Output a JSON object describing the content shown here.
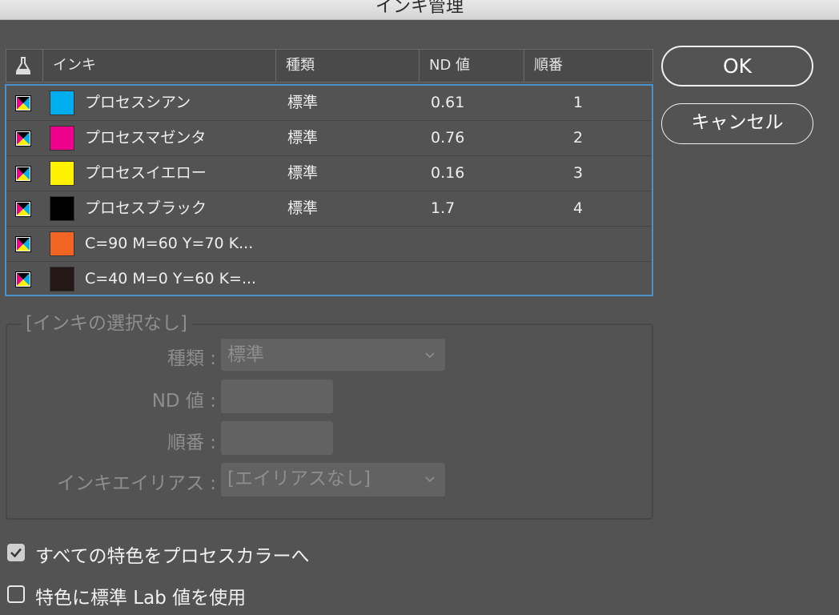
{
  "dialog": {
    "title": "インキ管理"
  },
  "table": {
    "columns": [
      "インキ",
      "種類",
      "ND 値",
      "順番"
    ],
    "rows": [
      {
        "name": "プロセスシアン",
        "type": "標準",
        "nd": "0.61",
        "order": "1",
        "color": "#00adef"
      },
      {
        "name": "プロセスマゼンタ",
        "type": "標準",
        "nd": "0.76",
        "order": "2",
        "color": "#ec008c"
      },
      {
        "name": "プロセスイエロー",
        "type": "標準",
        "nd": "0.16",
        "order": "3",
        "color": "#fff200"
      },
      {
        "name": "プロセスブラック",
        "type": "標準",
        "nd": "1.7",
        "order": "4",
        "color": "#000000"
      },
      {
        "name": "C=90 M=60 Y=70 K...",
        "type": "",
        "nd": "",
        "order": "",
        "color": "#f26522"
      },
      {
        "name": "C=40 M=0 Y=60 K=...",
        "type": "",
        "nd": "",
        "order": "",
        "color": "#231816"
      }
    ]
  },
  "buttons": {
    "ok": "OK",
    "cancel": "キャンセル"
  },
  "details": {
    "title": "[インキの選択なし]",
    "type_label": "種類 :",
    "type_value": "標準",
    "nd_label": "ND 値 :",
    "nd_value": "",
    "order_label": "順番 :",
    "order_value": "",
    "alias_label": "インキエイリアス :",
    "alias_value": "[エイリアスなし]"
  },
  "options": {
    "all_spots_to_process": {
      "label": "すべての特色をプロセスカラーへ",
      "checked": true
    },
    "use_lab_values": {
      "label": "特色に標準 Lab 値を使用",
      "checked": false
    }
  },
  "colors": {
    "selection_border": "#4d91cc",
    "background": "#535353"
  }
}
